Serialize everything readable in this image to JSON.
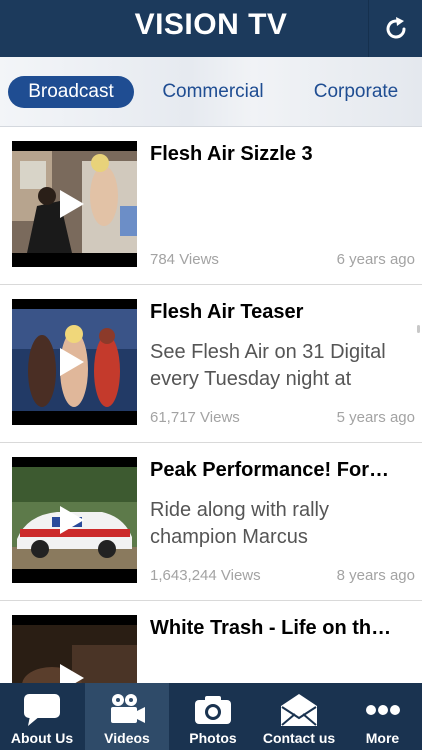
{
  "header": {
    "title": "VISION TV",
    "refresh_icon": "refresh-icon"
  },
  "segments": [
    {
      "label": "Broadcast",
      "active": true
    },
    {
      "label": "Commercial",
      "active": false
    },
    {
      "label": "Corporate",
      "active": false
    }
  ],
  "videos": [
    {
      "title": "Flesh Air Sizzle 3",
      "description": "",
      "views": "784 Views",
      "age": "6 years ago"
    },
    {
      "title": "Flesh Air Teaser",
      "description": "See Flesh Air on 31 Digital every Tuesday night at",
      "views": "61,717 Views",
      "age": "5 years ago"
    },
    {
      "title": "Peak Performance! For…",
      "description": "Ride along with rally champion Marcus",
      "views": "1,643,244 Views",
      "age": "8 years ago"
    },
    {
      "title": "White Trash - Life on th…",
      "description": "",
      "views": "",
      "age": ""
    }
  ],
  "tabs": [
    {
      "label": "About Us",
      "icon": "speech-bubble-icon",
      "active": false
    },
    {
      "label": "Videos",
      "icon": "video-camera-icon",
      "active": true
    },
    {
      "label": "Photos",
      "icon": "camera-icon",
      "active": false
    },
    {
      "label": "Contact us",
      "icon": "envelope-icon",
      "active": false
    },
    {
      "label": "More",
      "icon": "more-dots-icon",
      "active": false
    }
  ],
  "colors": {
    "header": "#1c3a5c",
    "accent": "#1f4d92",
    "tabbar": "#1a3350",
    "tab_active": "#2f4b69"
  }
}
